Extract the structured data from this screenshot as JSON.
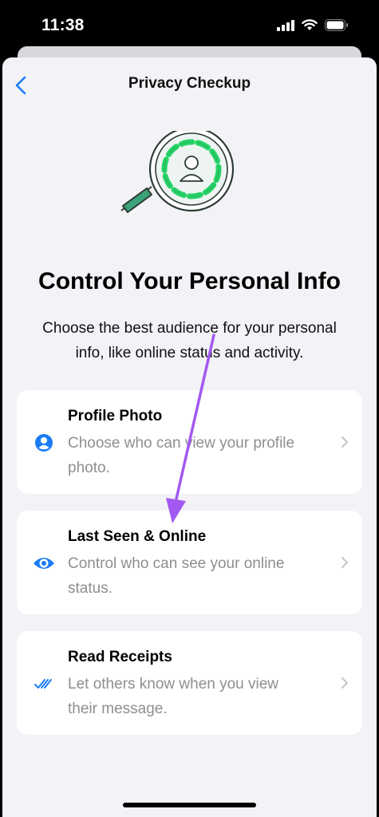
{
  "status_bar": {
    "time": "11:38"
  },
  "nav": {
    "title": "Privacy Checkup"
  },
  "headline": "Control Your Personal Info",
  "subtitle": "Choose the best audience for your personal info, like online status and activity.",
  "cards": [
    {
      "title": "Profile Photo",
      "description": "Choose who can view your profile photo.",
      "icon": "person-circle-icon"
    },
    {
      "title": "Last Seen & Online",
      "description": "Control who can see your online status.",
      "icon": "eye-icon"
    },
    {
      "title": "Read Receipts",
      "description": "Let others know when you view their message.",
      "icon": "double-check-icon"
    }
  ],
  "colors": {
    "accent": "#1b7cf6",
    "green": "#25d366",
    "teal": "#3ba37a",
    "annotation": "#a259f0"
  }
}
